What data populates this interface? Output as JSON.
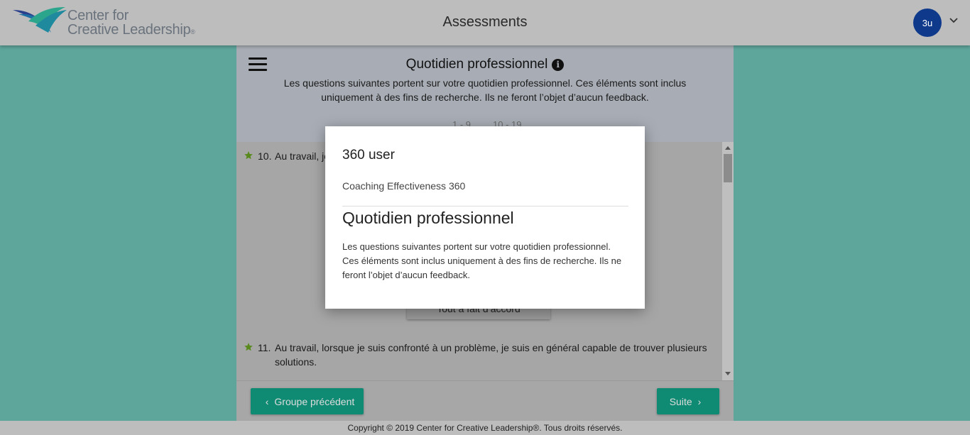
{
  "app": {
    "logo_line1": "Center for",
    "logo_line2": "Creative Leadership",
    "logo_mark": "®",
    "title": "Assessments",
    "user_initials": "3u"
  },
  "colors": {
    "page_background": "#5ea59c",
    "header_background": "#bdbdbd",
    "avatar_background": "#0f3a8c",
    "button_background": "#0f8a73",
    "star_color": "#5a8a1e"
  },
  "section": {
    "title": "Quotidien professionnel",
    "description": "Les questions suivantes portent sur votre quotidien professionnel. Ces éléments sont inclus uniquement à des fins de recherche. Ils ne feront l’objet d’aucun feedback.",
    "pages": [
      "1 - 9",
      "10 - 19"
    ]
  },
  "questions": [
    {
      "number": "10.",
      "text": "Au travail, je … compter sur mes compétence…"
    },
    {
      "number": "11.",
      "text": "Au travail, lorsque je suis confronté à un problème, je suis en général capable de trouver plusieurs solutions."
    }
  ],
  "answer_partial": "Tout à fait d’accord",
  "nav": {
    "prev_label": "Groupe précédent",
    "next_label": "Suite"
  },
  "footer": {
    "copyright": "Copyright © 2019 Center for Creative Leadership®. Tous droits réservés."
  },
  "modal": {
    "user": "360 user",
    "assessment": "Coaching Effectiveness 360",
    "title": "Quotidien professionnel",
    "description": "Les questions suivantes portent sur votre quotidien professionnel. Ces éléments sont inclus uniquement à des fins de recherche. Ils ne feront l’objet d’aucun feedback."
  },
  "icons": {
    "menu": "hamburger-icon",
    "info": "info-icon",
    "star": "star-icon",
    "user_menu": "chevron-down-icon",
    "prev": "chevron-left-icon",
    "next": "chevron-right-icon"
  }
}
